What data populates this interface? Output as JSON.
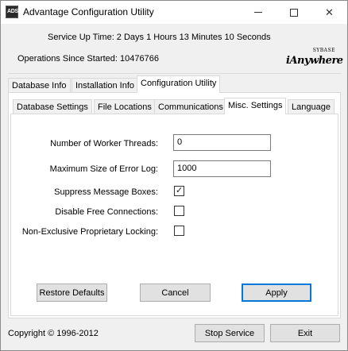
{
  "window": {
    "title": "Advantage Configuration Utility",
    "icon_text": "ADS",
    "icon_name": "ads-app-icon"
  },
  "header": {
    "uptime": "Service Up Time: 2 Days 1 Hours 13 Minutes 10 Seconds",
    "operations": "Operations Since Started: 10476766",
    "logo_small": "SYBASE",
    "logo_main": "iAnywhere"
  },
  "outer_tabs": [
    "Database Info",
    "Installation Info",
    "Configuration Utility"
  ],
  "inner_tabs": [
    "Database Settings",
    "File Locations",
    "Communications",
    "Misc. Settings",
    "Language"
  ],
  "settings": {
    "worker_threads_label": "Number of Worker Threads:",
    "worker_threads_value": "0",
    "error_log_label": "Maximum Size of Error Log:",
    "error_log_value": "1000",
    "suppress_label": "Suppress Message Boxes:",
    "suppress_checked": true,
    "disable_free_label": "Disable Free Connections:",
    "disable_free_checked": false,
    "non_exclusive_label": "Non-Exclusive Proprietary Locking:",
    "non_exclusive_checked": false
  },
  "buttons": {
    "restore": "Restore Defaults",
    "cancel": "Cancel",
    "apply": "Apply",
    "stop": "Stop Service",
    "exit": "Exit"
  },
  "footer": {
    "copyright": "Copyright © 1996-2012"
  }
}
